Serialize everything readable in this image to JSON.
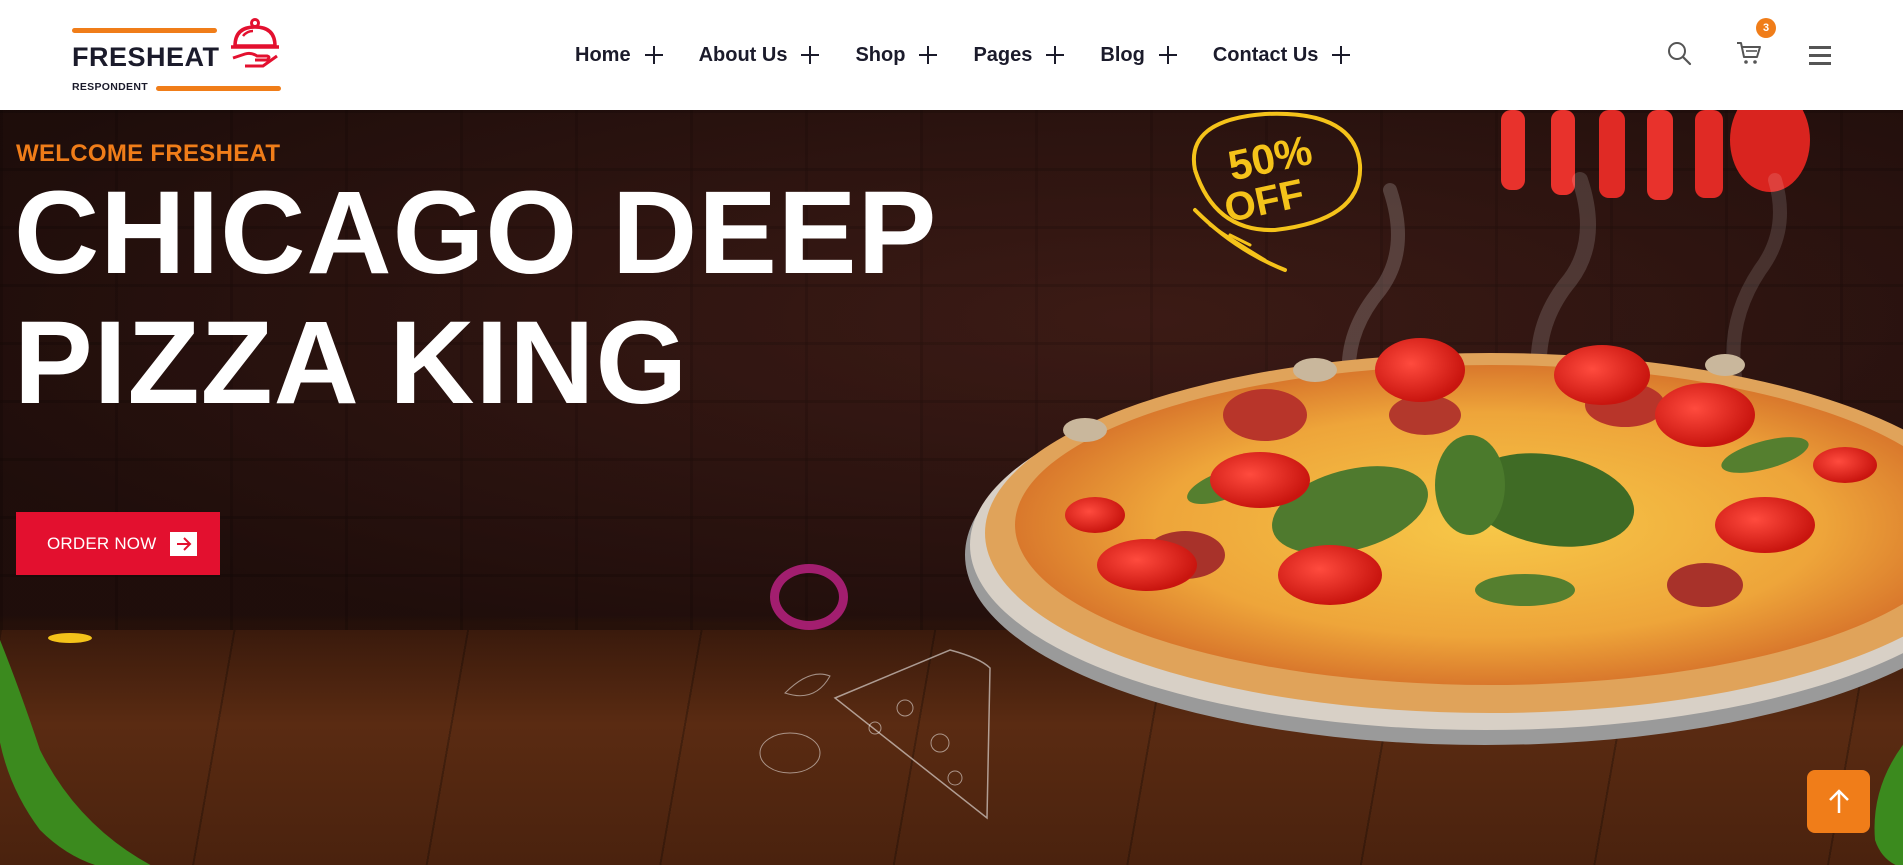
{
  "header": {
    "logo": {
      "name": "FRESHEAT",
      "tagline": "RESPONDENT",
      "icon": "cloche-hand-icon"
    },
    "nav": [
      {
        "label": "Home"
      },
      {
        "label": "About Us"
      },
      {
        "label": "Shop"
      },
      {
        "label": "Pages"
      },
      {
        "label": "Blog"
      },
      {
        "label": "Contact Us"
      }
    ],
    "icons": {
      "search": "search-icon",
      "cart": "cart-icon",
      "menu": "hamburger-menu-icon"
    },
    "cart_count": "3"
  },
  "hero": {
    "eyebrow": "WELCOME FRESHEAT",
    "title_line1": "CHICAGO DEEP",
    "title_line2": "PIZZA KING",
    "cta_label": "ORDER NOW",
    "offer_line1": "50%",
    "offer_line2": "OFF"
  },
  "colors": {
    "accent": "#f07d19",
    "cta": "#e3102f",
    "offer": "#f5c31a",
    "text_dark": "#1b1b2b"
  }
}
